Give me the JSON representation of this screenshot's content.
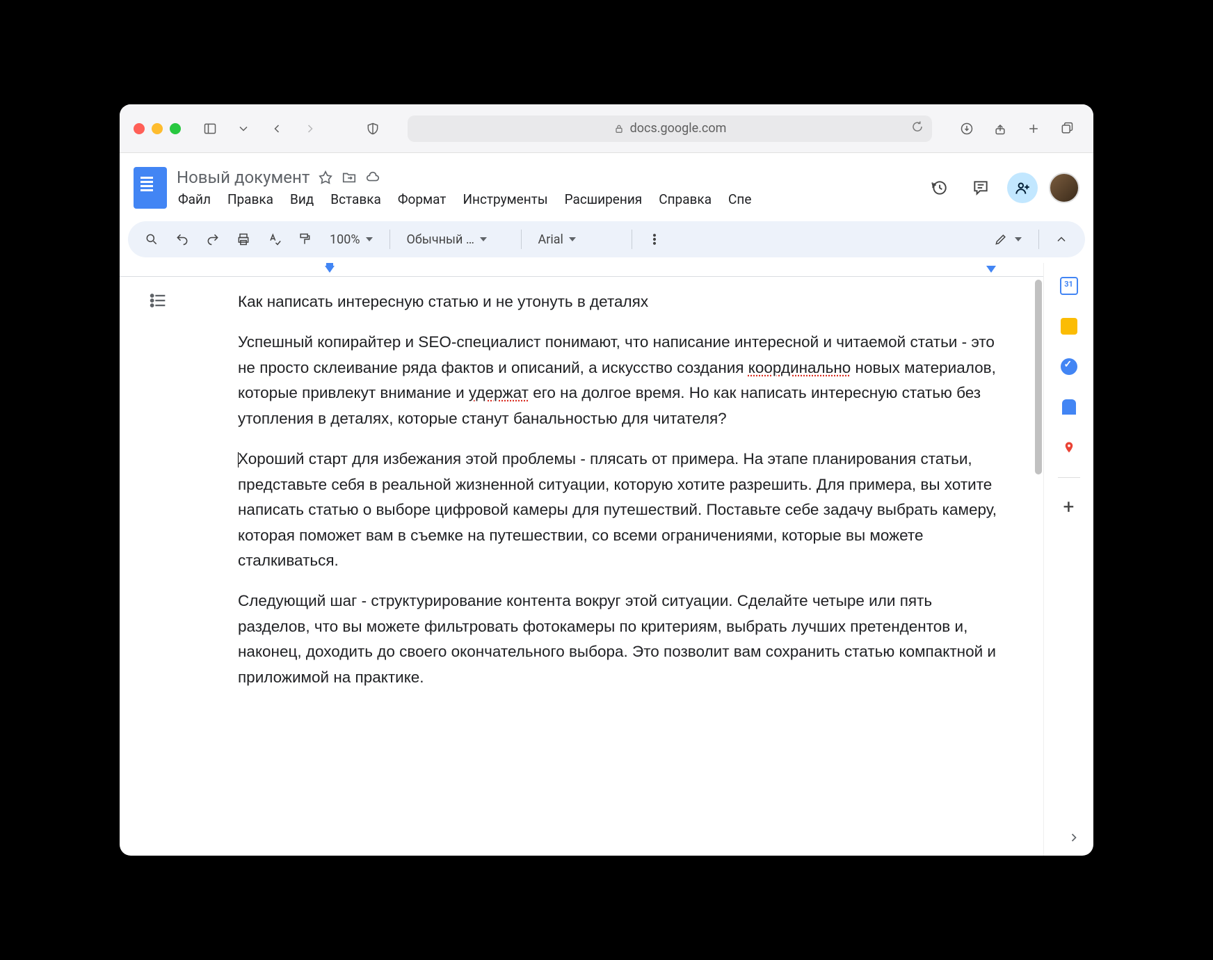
{
  "browser": {
    "url": "docs.google.com"
  },
  "doc": {
    "title": "Новый документ"
  },
  "menu": {
    "file": "Файл",
    "edit": "Правка",
    "view": "Вид",
    "insert": "Вставка",
    "format": "Формат",
    "tools": "Инструменты",
    "extensions": "Расширения",
    "help": "Справка",
    "truncated": "Спе"
  },
  "toolbar": {
    "zoom": "100%",
    "style": "Обычный …",
    "font": "Arial"
  },
  "sidepanel": {
    "calendar_day": "31"
  },
  "content": {
    "heading": "Как написать интересную статью и не утонуть в деталях",
    "p1_a": "Успешный копирайтер и SEO-специалист понимают, что написание интересной и читаемой статьи - это не просто склеивание ряда фактов и описаний, а искусство создания ",
    "p1_u1": "координально",
    "p1_b": " новых материалов, которые привлекут внимание и ",
    "p1_u2": "удержат",
    "p1_c": " его на долгое время. Но как написать интересную статью без утопления в деталях, которые станут банальностью для читателя?",
    "p2": "Хороший старт для избежания этой проблемы - плясать от примера. На этапе планирования статьи, представьте себя в реальной жизненной ситуации, которую хотите разрешить. Для примера, вы хотите написать статью о выборе цифровой камеры для путешествий. Поставьте себе задачу выбрать камеру, которая поможет вам в съемке на путешествии, со всеми ограничениями, которые вы можете сталкиваться.",
    "p3": "Следующий шаг - структурирование контента вокруг этой ситуации. Сделайте четыре или пять разделов, что вы можете фильтровать фотокамеры по критериям, выбрать лучших претендентов и, наконец, доходить до своего окончательного выбора. Это позволит вам сохранить статью компактной и приложимой на практике."
  }
}
